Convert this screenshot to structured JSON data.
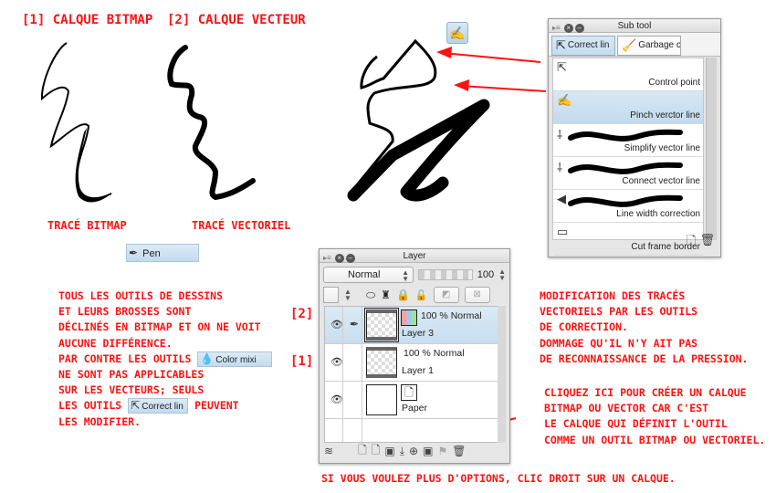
{
  "headings": {
    "bitmap_layer": "[1] Calque bitmap",
    "vector_layer": "[2] Calque vecteur"
  },
  "captions": {
    "bitmap_stroke": "Tracé bitmap",
    "vector_stroke": "Tracé vectoriel"
  },
  "pen_chip": {
    "icon": "pen-nib-icon",
    "label": "Pen"
  },
  "pinch_tool_button": {
    "icon": "pinch-vector-icon"
  },
  "subtool_palette": {
    "title": "Sub tool",
    "tabs": [
      {
        "label": "Correct lin",
        "icon": "correct-line-icon",
        "active": true
      },
      {
        "label": "Garbage c",
        "icon": "broom-icon",
        "active": false
      }
    ],
    "items": [
      {
        "label": "Control point",
        "icon": "control-point-icon",
        "selected": false,
        "stroke": false
      },
      {
        "label": "Pinch verctor line",
        "icon": "pinch-vector-icon",
        "selected": true,
        "stroke": false
      },
      {
        "label": "Simplify vector line",
        "icon": "simplify-icon",
        "selected": false,
        "stroke": true
      },
      {
        "label": "Connect vector line",
        "icon": "connect-icon",
        "selected": false,
        "stroke": true
      },
      {
        "label": "Line width correction",
        "icon": "line-width-icon",
        "selected": false,
        "stroke": true
      },
      {
        "label": "Cut frame border",
        "icon": "cut-frame-icon",
        "selected": false,
        "stroke": false
      }
    ],
    "footer": [
      "new-subtool-icon",
      "trash-icon"
    ]
  },
  "layer_palette": {
    "title": "Layer",
    "blend_mode": "Normal",
    "opacity": "100",
    "layers": [
      {
        "marker": "[2]",
        "blend": "100 % Normal",
        "name": "Layer 3",
        "selected": true,
        "visible": true,
        "editing": true,
        "type": "vector"
      },
      {
        "marker": "[1]",
        "blend": "100 % Normal",
        "name": "Layer 1",
        "selected": false,
        "visible": true,
        "editing": false,
        "type": "raster"
      },
      {
        "marker": "",
        "blend": "",
        "name": "Paper",
        "selected": false,
        "visible": true,
        "editing": false,
        "type": "paper"
      }
    ],
    "footer_icons": [
      "layer-stack-icon",
      "new-raster-layer-icon",
      "new-vector-layer-icon",
      "new-folder-icon",
      "merge-down-icon",
      "merge-visible-icon",
      "mask-icon",
      "ruler-icon",
      "trash-icon"
    ]
  },
  "notes": {
    "left": [
      "Tous les outils de dessins",
      "et leurs brosses sont",
      "déclinés en bitmap et on ne voit",
      "aucune différence.",
      "Par contre les outils",
      "ne sont pas applicables",
      "sur les vecteurs; seuls",
      "les outils",
      "peuvent",
      "les modifier."
    ],
    "color_mix_chip": "Color mixi",
    "correct_line_chip": "Correct lin",
    "right_top": [
      "Modification des tracés",
      "vectoriels par les outils",
      "de correction.",
      "Dommage qu'il n'y ait pas",
      "de reconnaissance de la pression."
    ],
    "right_bottom": [
      "Cliquez ici pour créer un calque",
      "bitmap ou vector car c'est",
      "le calque qui définit l'outil",
      "comme un outil bitmap ou vectoriel."
    ],
    "bottom": "Si vous voulez plus d'options, clic droit sur un calque."
  },
  "colors": {
    "annotation_red": "#ff1111",
    "selection_blue": "#c8ddee"
  }
}
